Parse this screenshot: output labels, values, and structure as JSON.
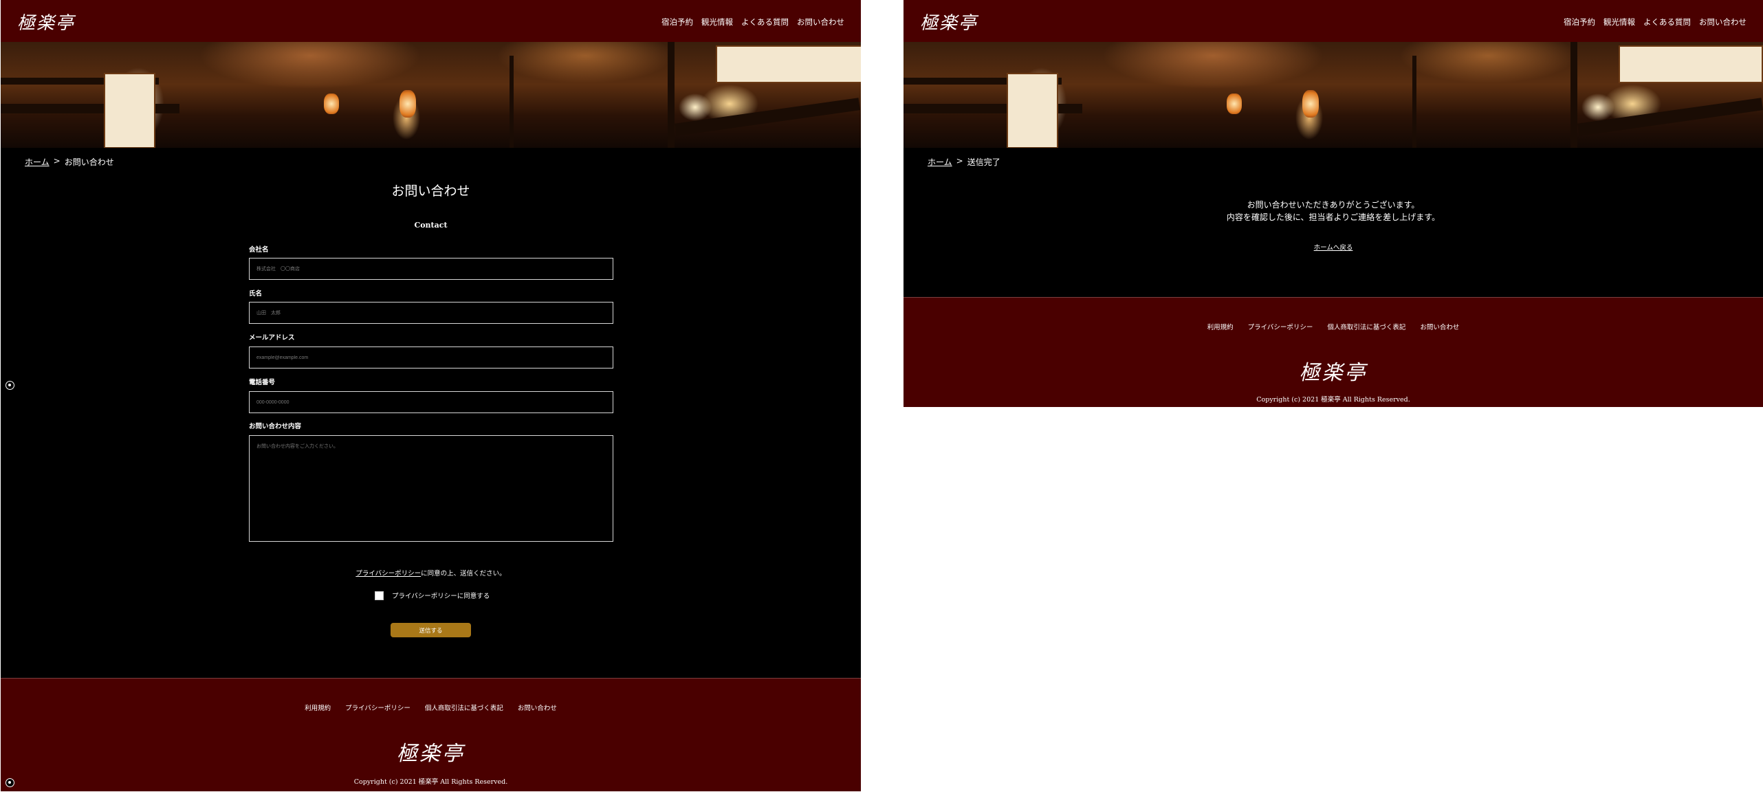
{
  "brand": {
    "logo": "極楽亭"
  },
  "nav": [
    "宿泊予約",
    "観光情報",
    "よくある質問",
    "お問い合わせ"
  ],
  "contact_page": {
    "breadcrumb": {
      "home": "ホーム",
      "separator": ">",
      "current": "お問い合わせ"
    },
    "title": "お問い合わせ",
    "subtitle": "Contact",
    "fields": [
      {
        "label": "会社名",
        "placeholder": "株式会社　〇〇商店"
      },
      {
        "label": "氏名",
        "placeholder": "山田　太郎"
      },
      {
        "label": "メールアドレス",
        "placeholder": "example@example.com"
      },
      {
        "label": "電話番号",
        "placeholder": "000-0000-0000"
      },
      {
        "label": "お問い合わせ内容",
        "placeholder": "お問い合わせ内容をご入力ください。"
      }
    ],
    "consent_link": "プライバシーポリシー",
    "consent_text": "に同意の上、送信ください。",
    "checkbox_label": "プライバシーポリシーに同意する",
    "submit_label": "送信する"
  },
  "complete_page": {
    "breadcrumb": {
      "home": "ホーム",
      "separator": ">",
      "current": "送信完了"
    },
    "message_line1": "お問い合わせいただきありがとうございます。",
    "message_line2": "内容を確認した後に、担当者よりご連絡を差し上げます。",
    "back_link": "ホームへ戻る"
  },
  "footer": {
    "links": [
      "利用規約",
      "プライバシーポリシー",
      "個人商取引法に基づく表記",
      "お問い合わせ"
    ],
    "logo": "極楽亭",
    "copyright": "Copyright (c) 2021 極楽亭 All Rights Reserved."
  },
  "colors": {
    "header_bg": "#4a0000",
    "body_bg": "#000000",
    "button_bg": "#a97818"
  }
}
